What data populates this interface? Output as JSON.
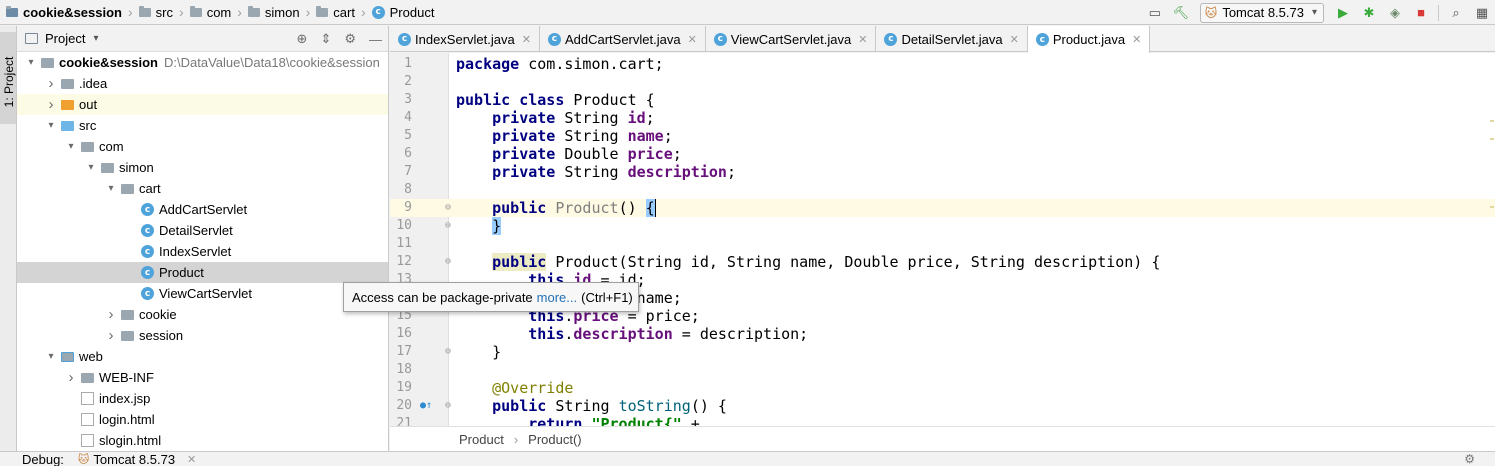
{
  "breadcrumbs": [
    "cookie&session",
    "src",
    "com",
    "simon",
    "cart",
    "Product"
  ],
  "toolbar": {
    "run_config": "Tomcat 8.5.73",
    "icons": [
      "window-icon",
      "hammer-icon",
      "run-icon",
      "debug-icon",
      "coverage-icon",
      "stop-icon",
      "search-icon",
      "settings-icon"
    ]
  },
  "left_strip": {
    "tab_label": "1: Project"
  },
  "project_panel": {
    "title": "Project",
    "tree": [
      {
        "label": "cookie&session",
        "extra": "D:\\DataValue\\Data18\\cookie&session",
        "depth": 0,
        "expanded": true,
        "kind": "project"
      },
      {
        "label": ".idea",
        "depth": 1,
        "expanded": false,
        "kind": "folder"
      },
      {
        "label": "out",
        "depth": 1,
        "expanded": false,
        "kind": "folder-orange"
      },
      {
        "label": "src",
        "depth": 1,
        "expanded": true,
        "kind": "folder-blue"
      },
      {
        "label": "com",
        "depth": 2,
        "expanded": true,
        "kind": "folder"
      },
      {
        "label": "simon",
        "depth": 3,
        "expanded": true,
        "kind": "folder"
      },
      {
        "label": "cart",
        "depth": 4,
        "expanded": true,
        "kind": "folder"
      },
      {
        "label": "AddCartServlet",
        "depth": 5,
        "kind": "class"
      },
      {
        "label": "DetailServlet",
        "depth": 5,
        "kind": "class"
      },
      {
        "label": "IndexServlet",
        "depth": 5,
        "kind": "class"
      },
      {
        "label": "Product",
        "depth": 5,
        "kind": "class",
        "selected": true
      },
      {
        "label": "ViewCartServlet",
        "depth": 5,
        "kind": "class"
      },
      {
        "label": "cookie",
        "depth": 4,
        "expanded": false,
        "kind": "folder"
      },
      {
        "label": "session",
        "depth": 4,
        "expanded": false,
        "kind": "folder"
      },
      {
        "label": "web",
        "depth": 1,
        "expanded": true,
        "kind": "folder-web"
      },
      {
        "label": "WEB-INF",
        "depth": 2,
        "expanded": false,
        "kind": "folder"
      },
      {
        "label": "index.jsp",
        "depth": 2,
        "kind": "jsp"
      },
      {
        "label": "login.html",
        "depth": 2,
        "kind": "html"
      },
      {
        "label": "slogin.html",
        "depth": 2,
        "kind": "html"
      }
    ]
  },
  "editor_tabs": [
    {
      "label": "IndexServlet.java",
      "active": false
    },
    {
      "label": "AddCartServlet.java",
      "active": false
    },
    {
      "label": "ViewCartServlet.java",
      "active": false
    },
    {
      "label": "DetailServlet.java",
      "active": false
    },
    {
      "label": "Product.java",
      "active": true
    }
  ],
  "code_lines": [
    {
      "n": "1",
      "html": "<span class=\"kw\">package</span> com.simon.cart;"
    },
    {
      "n": "2",
      "html": ""
    },
    {
      "n": "3",
      "html": "<span class=\"kw\">public class</span> Product {"
    },
    {
      "n": "4",
      "html": "    <span class=\"kw\">private</span> String <span class=\"fld\">id</span>;"
    },
    {
      "n": "5",
      "html": "    <span class=\"kw\">private</span> String <span class=\"fld\">name</span>;"
    },
    {
      "n": "6",
      "html": "    <span class=\"kw\">private</span> Double <span class=\"fld\">price</span>;"
    },
    {
      "n": "7",
      "html": "    <span class=\"kw\">private</span> String <span class=\"fld\">description</span>;"
    },
    {
      "n": "8",
      "html": ""
    },
    {
      "n": "9",
      "html": "    <span class=\"kw\">public</span> <span class=\"mthgray\">Product</span>() <span class=\"match\">{</span><span class=\"caretbox\"></span>",
      "current": true,
      "fold": true
    },
    {
      "n": "10",
      "html": "    <span class=\"match\">}</span>",
      "fold": true
    },
    {
      "n": "11",
      "html": ""
    },
    {
      "n": "12",
      "html": "    <span class=\"kw kwhl\">public</span> Product(String id, String name, Double price, String description) {",
      "fold": true
    },
    {
      "n": "13",
      "html": "        <span class=\"kw\">this</span>.<span class=\"fld\">id</span> = id;"
    },
    {
      "n": "14",
      "html": "        <span class=\"kw\">this</span>.<span class=\"fld\">name</span> = name;"
    },
    {
      "n": "15",
      "html": "        <span class=\"kw\">this</span>.<span class=\"fld\">price</span> = price;"
    },
    {
      "n": "16",
      "html": "        <span class=\"kw\">this</span>.<span class=\"fld\">description</span> = description;"
    },
    {
      "n": "17",
      "html": "    }",
      "fold": true
    },
    {
      "n": "18",
      "html": ""
    },
    {
      "n": "19",
      "html": "    <span class=\"ann\">@Override</span>"
    },
    {
      "n": "20",
      "html": "    <span class=\"kw\">public</span> String <span class=\"mth\">toString</span>() {",
      "fold": true,
      "override": true
    },
    {
      "n": "21",
      "html": "        <span class=\"kw\">return</span> <span class=\"str\">\"Product{\"</span> +"
    }
  ],
  "editor_breadcrumb": [
    "Product",
    "Product()"
  ],
  "tooltip": {
    "text": "Access can be package-private",
    "link": "more...",
    "shortcut": "(Ctrl+F1)"
  },
  "bottom_bar": {
    "label": "Debug:",
    "config": "Tomcat 8.5.73"
  }
}
